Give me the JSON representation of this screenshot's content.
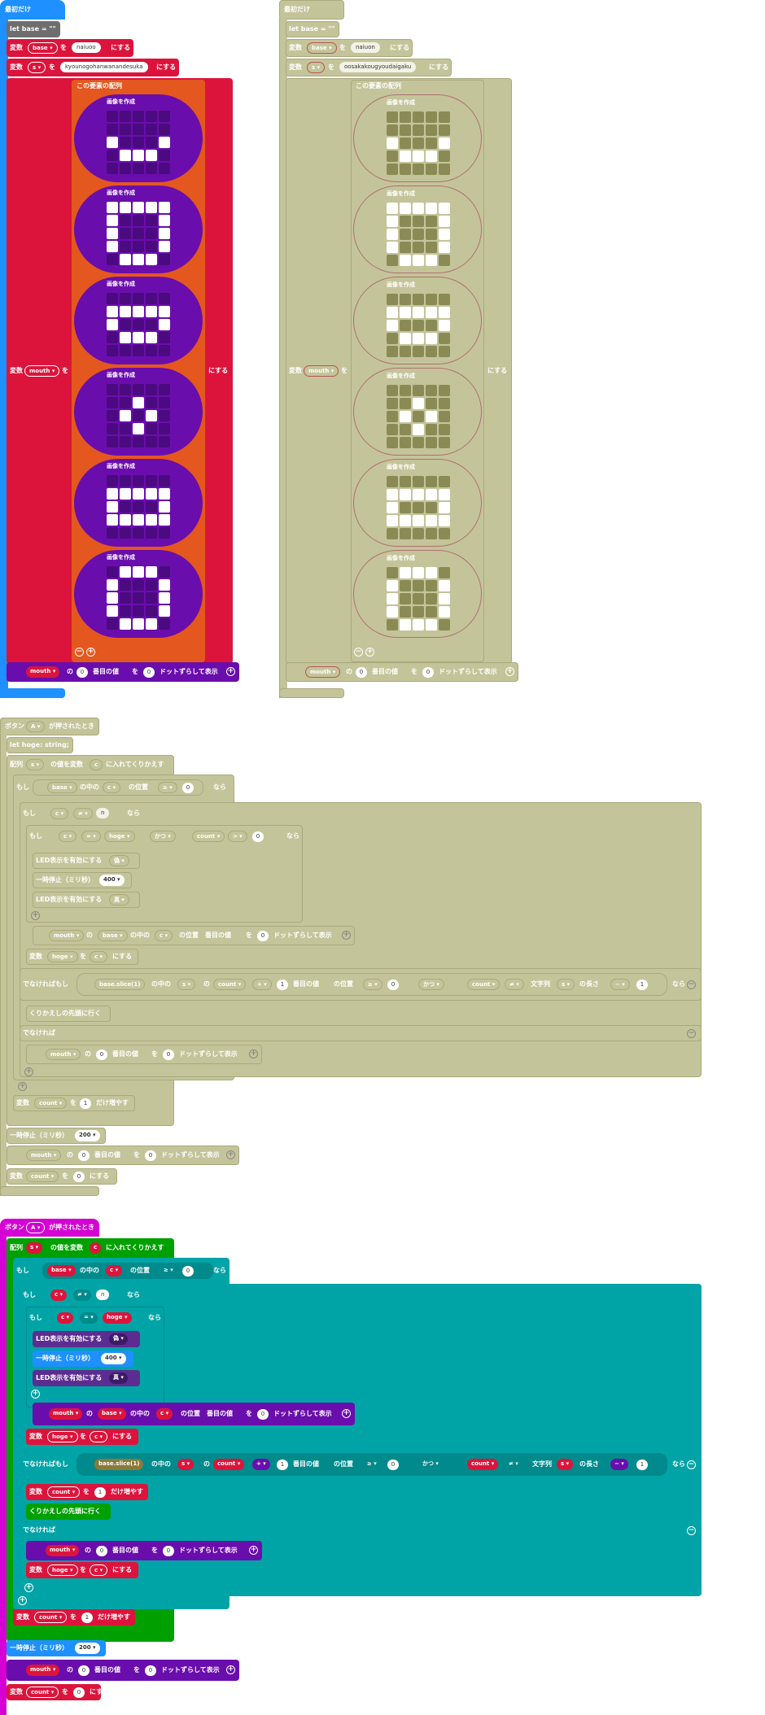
{
  "colors": {
    "event_blue": "#1e90ff",
    "var_red": "#dc143c",
    "array_orange": "#e4571f",
    "image_purple": "#6a0dad",
    "led_purple": "#5c2d91",
    "pause_blue": "#1e90ff",
    "loop_green": "#00a000",
    "logic_teal": "#00a4a6",
    "input_magenta": "#d400d4",
    "disabled_fill": "#c4c49a",
    "disabled_border": "#a9a97c",
    "led_off": "#4b0a80",
    "led_on": "#ffffff",
    "disabled_led_off": "#8a8a55",
    "disabled_led_on": "#ffffff"
  },
  "start_block": {
    "header": "最初だけ",
    "let_base": "let base = \"\"",
    "set_base": {
      "prefix": "変数",
      "var": "base ▾",
      "op": "を",
      "value": "naiuoo",
      "suffix": "にする"
    },
    "set_s": {
      "prefix": "変数",
      "var": "s ▾",
      "op": "を",
      "value": "kyounogohanwanandesuka",
      "suffix": "にする"
    },
    "set_mouth": {
      "prefix": "変数",
      "var": "mouth ▾",
      "op": "を",
      "suffix": "にする"
    },
    "array_label": "この要素の配列",
    "image_label": "画像を作成",
    "show": {
      "var": "mouth ▾",
      "of": "の",
      "index": "0",
      "nth": "番目の値",
      "wo": "を",
      "offset": "0",
      "label": "ドットずらして表示"
    }
  },
  "start_block_disabled": {
    "header": "最初だけ",
    "let_base": "let base = \"\"",
    "set_base": {
      "prefix": "変数",
      "var": "base ▾",
      "op": "を",
      "value": "naiuon",
      "suffix": "にする"
    },
    "set_s": {
      "prefix": "変数",
      "var": "s ▾",
      "op": "を",
      "value": "oosakakougyoudaigaku",
      "suffix": "にする"
    },
    "set_mouth": {
      "prefix": "変数",
      "var": "mouth ▾",
      "op": "を",
      "suffix": "にする"
    },
    "array_label": "この要素の配列",
    "image_label": "画像を作成",
    "show": {
      "var": "mouth ▾",
      "of": "の",
      "index": "0",
      "nth": "番目の値",
      "wo": "を",
      "offset": "0",
      "label": "ドットずらして表示"
    }
  },
  "images": [
    [
      0,
      0,
      0,
      0,
      0,
      0,
      0,
      0,
      0,
      0,
      1,
      0,
      0,
      0,
      1,
      0,
      1,
      1,
      1,
      0,
      0,
      0,
      0,
      0,
      0
    ],
    [
      1,
      1,
      1,
      1,
      1,
      1,
      0,
      0,
      0,
      1,
      1,
      0,
      0,
      0,
      1,
      1,
      0,
      0,
      0,
      1,
      0,
      1,
      1,
      1,
      0
    ],
    [
      0,
      0,
      0,
      0,
      0,
      1,
      1,
      1,
      1,
      1,
      1,
      0,
      0,
      0,
      1,
      0,
      1,
      1,
      1,
      0,
      0,
      0,
      0,
      0,
      0
    ],
    [
      0,
      0,
      0,
      0,
      0,
      0,
      0,
      1,
      0,
      0,
      0,
      1,
      0,
      1,
      0,
      0,
      0,
      1,
      0,
      0,
      0,
      0,
      0,
      0,
      0
    ],
    [
      0,
      0,
      0,
      0,
      0,
      1,
      1,
      1,
      1,
      1,
      1,
      0,
      0,
      0,
      1,
      1,
      1,
      1,
      1,
      1,
      0,
      0,
      0,
      0,
      0
    ],
    [
      0,
      1,
      1,
      1,
      0,
      1,
      0,
      0,
      0,
      1,
      1,
      0,
      0,
      0,
      1,
      1,
      0,
      0,
      0,
      1,
      0,
      1,
      1,
      1,
      0
    ]
  ],
  "button_disabled": {
    "header": "ボタン",
    "button": "A ▾",
    "header_suffix": "が押されたとき",
    "let_hoge": "let hoge: string;",
    "foreach": {
      "prefix": "配列",
      "arr": "s ▾",
      "mid": "の値を変数",
      "var": "c",
      "suffix": "に入れてくりかえす"
    },
    "if1": {
      "kw": "もし",
      "base": "base ▾",
      "the": "の中の",
      "c": "c ▾",
      "pos": "の位置",
      "op": "≥ ▾",
      "num": "0",
      "then": "なら"
    },
    "if2": {
      "kw": "もし",
      "c": "c ▾",
      "op": "≠ ▾",
      "str": "n",
      "then": "なら"
    },
    "if3": {
      "kw": "もし",
      "c": "c ▾",
      "op": "= ▾",
      "hoge": "hoge ▾",
      "and": "かつ ▾",
      "count": "count ▾",
      "op2": "> ▾",
      "num": "0",
      "then": "なら"
    },
    "led_off": {
      "label": "LED表示を有効にする",
      "val": "偽 ▾"
    },
    "pause": {
      "label": "一時停止（ミリ秒）",
      "val": "400 ▾"
    },
    "led_on": {
      "label": "LED表示を有効にする",
      "val": "真 ▾"
    },
    "show_base": {
      "var": "mouth ▾",
      "of": "の",
      "base": "base ▾",
      "the": "の中の",
      "c": "c ▾",
      "pos": "の位置",
      "nth": "番目の値",
      "wo": "を",
      "offset": "0",
      "label": "ドットずらして表示"
    },
    "set_hoge": {
      "prefix": "変数",
      "var": "hoge ▾",
      "op": "を",
      "c": "c ▾",
      "suffix": "にする"
    },
    "elseif": {
      "kw": "でなければもし",
      "slice": "base.slice(1)",
      "the": "の中の",
      "s": "s ▾",
      "of": "の",
      "count": "count ▾",
      "plus": "+ ▾",
      "one": "1",
      "nth": "番目の値",
      "pos": "の位置",
      "op": "≥ ▾",
      "num": "0",
      "and": "かつ ▾",
      "count2": "count ▾",
      "op2": "≠ ▾",
      "len_label": "文字列",
      "len_s": "s ▾",
      "len_suffix": "の長さ",
      "minus": "− ▾",
      "one2": "1",
      "then": "なら"
    },
    "continue": "くりかえしの先頭に行く",
    "else": "でなければ",
    "show_zero": {
      "var": "mouth ▾",
      "of": "の",
      "index": "0",
      "nth": "番目の値",
      "wo": "を",
      "offset": "0",
      "label": "ドットずらして表示"
    },
    "count_inc": {
      "prefix": "変数",
      "var": "count ▾",
      "op": "を",
      "val": "1",
      "suffix": "だけ増やす"
    },
    "pause2": {
      "label": "一時停止（ミリ秒）",
      "val": "200 ▾"
    },
    "show_final": {
      "var": "mouth ▾",
      "of": "の",
      "index": "0",
      "nth": "番目の値",
      "wo": "を",
      "offset": "0",
      "label": "ドットずらして表示"
    },
    "set_count": {
      "prefix": "変数",
      "var": "count ▾",
      "op": "を",
      "val": "0",
      "suffix": "にする"
    }
  },
  "button_active": {
    "header": "ボタン",
    "button": "A ▾",
    "header_suffix": "が押されたとき",
    "foreach": {
      "prefix": "配列",
      "arr": "s ▾",
      "mid": "の値を変数",
      "var": "c",
      "suffix": "に入れてくりかえす"
    },
    "if1": {
      "kw": "もし",
      "base": "base ▾",
      "the": "の中の",
      "c": "c ▾",
      "pos": "の位置",
      "op": "≥ ▾",
      "num": "0",
      "then": "なら"
    },
    "if2": {
      "kw": "もし",
      "c": "c ▾",
      "op": "≠ ▾",
      "str": "n",
      "then": "なら"
    },
    "if3": {
      "kw": "もし",
      "c": "c ▾",
      "op": "= ▾",
      "hoge": "hoge ▾",
      "then": "なら"
    },
    "led_off": {
      "label": "LED表示を有効にする",
      "val": "偽 ▾"
    },
    "pause": {
      "label": "一時停止（ミリ秒）",
      "val": "400 ▾"
    },
    "led_on": {
      "label": "LED表示を有効にする",
      "val": "真 ▾"
    },
    "show_base": {
      "var": "mouth ▾",
      "of": "の",
      "base": "base ▾",
      "the": "の中の",
      "c": "c ▾",
      "pos": "の位置",
      "nth": "番目の値",
      "wo": "を",
      "offset": "0",
      "label": "ドットずらして表示"
    },
    "set_hoge": {
      "prefix": "変数",
      "var": "hoge ▾",
      "op": "を",
      "c": "c ▾",
      "suffix": "にする"
    },
    "elseif": {
      "kw": "でなければもし",
      "slice": "base.slice(1)",
      "the": "の中の",
      "s": "s ▾",
      "of": "の",
      "count": "count ▾",
      "plus": "+ ▾",
      "one": "1",
      "nth": "番目の値",
      "pos": "の位置",
      "op": "≥ ▾",
      "num": "0",
      "and": "かつ ▾",
      "count2": "count ▾",
      "op2": "≠ ▾",
      "len_label": "文字列",
      "len_s": "s ▾",
      "len_suffix": "の長さ",
      "minus": "− ▾",
      "one2": "1",
      "then": "なら"
    },
    "set_count0": {
      "prefix": "変数",
      "var": "count ▾",
      "op": "を",
      "val": "1",
      "suffix": "だけ増やす"
    },
    "continue": "くりかえしの先頭に行く",
    "else": "でなければ",
    "show_zero": {
      "var": "mouth ▾",
      "of": "の",
      "index": "0",
      "nth": "番目の値",
      "wo": "を",
      "offset": "0",
      "label": "ドットずらして表示"
    },
    "set_hoge2": {
      "prefix": "変数",
      "var": "hoge ▾",
      "op": "を",
      "c": "c ▾",
      "suffix": "にする"
    },
    "count_inc": {
      "prefix": "変数",
      "var": "count ▾",
      "op": "を",
      "val": "1",
      "suffix": "だけ増やす"
    },
    "pause2": {
      "label": "一時停止（ミリ秒）",
      "val": "200 ▾"
    },
    "show_final": {
      "var": "mouth ▾",
      "of": "の",
      "index": "0",
      "nth": "番目の値",
      "wo": "を",
      "offset": "0",
      "label": "ドットずらして表示"
    },
    "set_count": {
      "prefix": "変数",
      "var": "count ▾",
      "op": "を",
      "val": "0",
      "suffix": "にする"
    }
  }
}
